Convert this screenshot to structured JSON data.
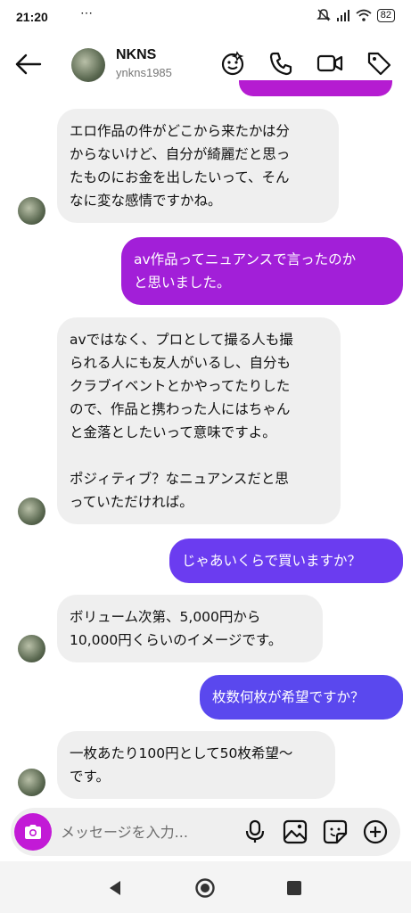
{
  "status": {
    "time": "21:20",
    "notif_dots": "⋯",
    "battery": "82"
  },
  "header": {
    "name": "NKNS",
    "handle": "ynkns1985",
    "icons": [
      "back-arrow-icon",
      "sticker-face-icon",
      "phone-icon",
      "video-camera-icon",
      "tag-icon"
    ]
  },
  "messages": [
    {
      "side": "in",
      "text": "エロ作品の件がどこから来たかは分\nからないけど、自分が綺麗だと思っ\nたものにお金を出したいって、そん\nなに変な感情ですかね。"
    },
    {
      "side": "out",
      "text": "av作品ってニュアンスで言ったのか\nと思いました。",
      "color": "#a21fd8"
    },
    {
      "side": "in",
      "text": "avではなく、プロとして撮る人も撮\nられる人にも友人がいるし、自分も\nクラブイベントとかやってたりした\nので、作品と携わった人にはちゃん\nと金落としたいって意味ですよ。\n\nポジィティブ？なニュアンスだと思\nっていただければ。"
    },
    {
      "side": "out",
      "text": "じゃあいくらで買いますか？",
      "color": "#6b3cf0"
    },
    {
      "side": "in",
      "text": "ボリューム次第、5,000円から\n10,000円くらいのイメージです。"
    },
    {
      "side": "out",
      "text": "枚数何枚が希望ですか？",
      "color": "#5a48ee"
    },
    {
      "side": "in",
      "text": "一枚あたり100円として50枚希望〜\nです。"
    }
  ],
  "composer": {
    "placeholder": "メッセージを入力...",
    "icons": [
      "camera-icon",
      "microphone-icon",
      "image-icon",
      "sticker-icon",
      "plus-circle-icon"
    ]
  },
  "colors": {
    "accent_purple": "#b51cd1",
    "incoming_bubble": "#efefef"
  }
}
